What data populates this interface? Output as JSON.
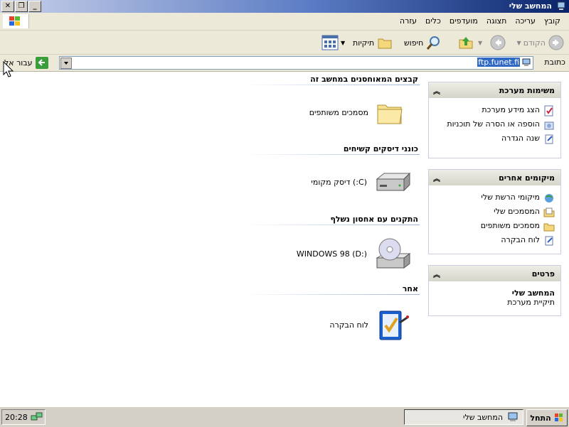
{
  "window": {
    "title": "המחשב שלי"
  },
  "menu": [
    "קובץ",
    "עריכה",
    "תצוגה",
    "מועדפים",
    "כלים",
    "עזרה"
  ],
  "toolbar": {
    "back": "הקודם",
    "search": "חיפוש",
    "folders": "תיקיות"
  },
  "address": {
    "label": "כתובת",
    "value": "ftp.funet.fi",
    "go": "עבור אל"
  },
  "panes": [
    {
      "title": "משימות מערכת",
      "items": [
        "הצג מידע מערכת",
        "הוספה או הסרה של תוכניות",
        "שנה הגדרה"
      ]
    },
    {
      "title": "מיקומים אחרים",
      "items": [
        "מיקומי הרשת שלי",
        "המסמכים שלי",
        "מסמכים משותפים",
        "לוח הבקרה"
      ]
    },
    {
      "title": "פרטים",
      "details": {
        "name": "המחשב שלי",
        "type": "תיקיית מערכת"
      }
    }
  ],
  "groups": [
    {
      "title": "קבצים המאוחסנים במחשב זה",
      "item": "מסמכים משותפים",
      "icon": "shared-folder-icon"
    },
    {
      "title": "כונני דיסקים קשיחים",
      "item": "(C:) דיסק מקומי",
      "icon": "hard-disk-icon"
    },
    {
      "title": "התקנים עם אחסון נשלף",
      "item": "WINDOWS 98 (D:)",
      "icon": "cd-drive-icon"
    },
    {
      "title": "אחר",
      "item": "לוח הבקרה",
      "icon": "control-panel-icon"
    }
  ],
  "taskbar": {
    "start": "התחל",
    "task": "המחשב שלי",
    "clock": "20:28"
  }
}
